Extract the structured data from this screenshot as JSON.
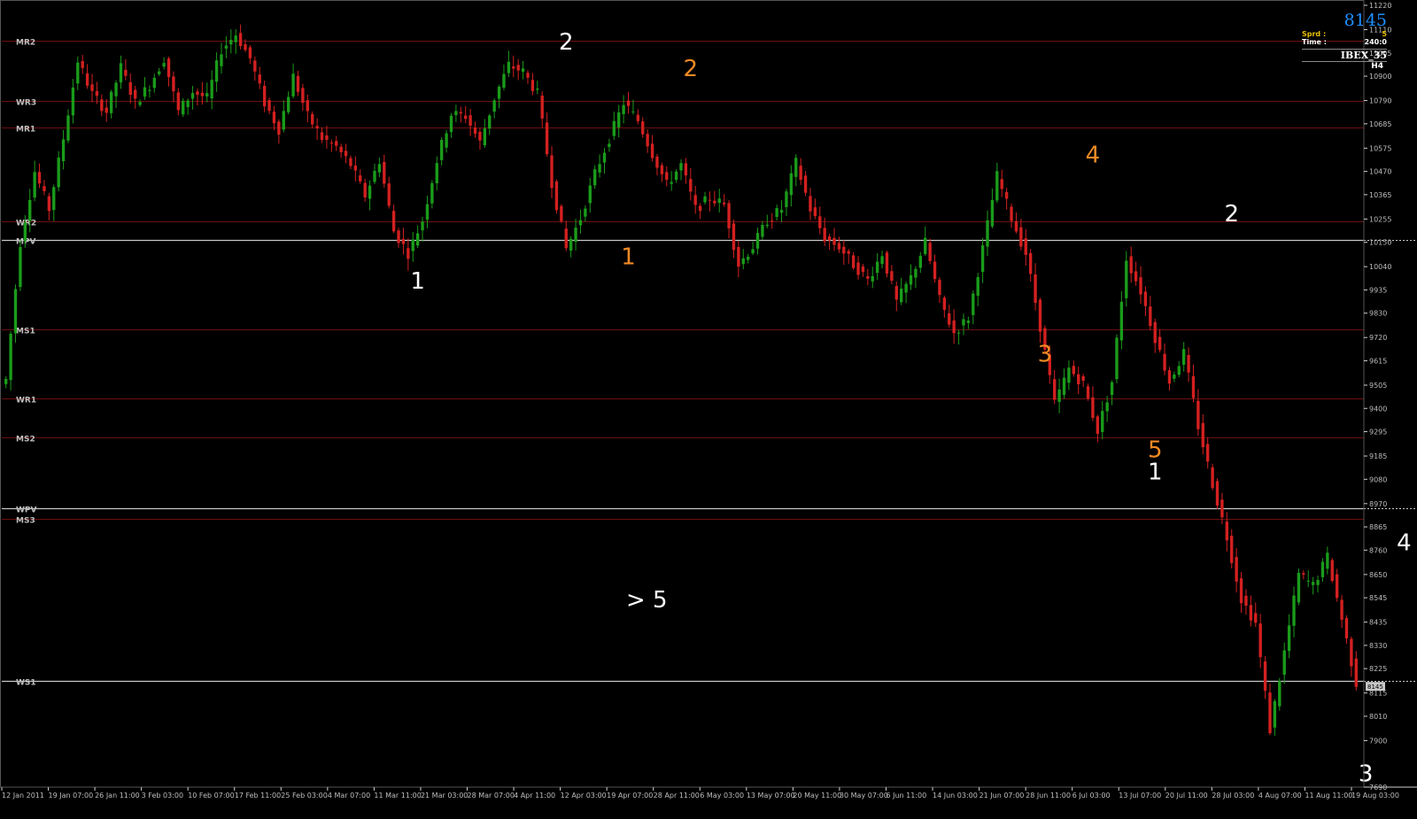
{
  "window": {
    "symbol": "IBEX_35",
    "timeframe": "H4"
  },
  "info_panel": {
    "price": "8145",
    "spread_label": "Sprd :",
    "spread_value": "5",
    "time_label": "Time :",
    "time_value": "240:0",
    "symbol": "IBEX_35",
    "timeframe": "H4"
  },
  "colors": {
    "bull": "#1a9c1a",
    "bear": "#d42020",
    "grid": "#6b1010",
    "pivot_line": "#c8c8c8",
    "wave_white": "#ffffff",
    "wave_orange": "#f08a24",
    "background": "#000000"
  },
  "current_price_tag": "8145",
  "chart_data": {
    "type": "candlestick",
    "ylim": [
      7690,
      11220
    ],
    "y_ticks": [
      11220,
      11110,
      11005,
      10900,
      10790,
      10685,
      10575,
      10470,
      10365,
      10255,
      10150,
      10040,
      9935,
      9830,
      9720,
      9615,
      9505,
      9400,
      9295,
      9185,
      9080,
      8970,
      8865,
      8760,
      8650,
      8545,
      8435,
      8330,
      8225,
      8115,
      8010,
      7900,
      7690
    ],
    "x_ticks": [
      "12 Jan 2011",
      "19 Jan 07:00",
      "26 Jan 11:00",
      "3 Feb 03:00",
      "10 Feb 07:00",
      "17 Feb 11:00",
      "25 Feb 03:00",
      "4 Mar 07:00",
      "11 Mar 11:00",
      "21 Mar 03:00",
      "28 Mar 07:00",
      "4 Apr 11:00",
      "12 Apr 03:00",
      "19 Apr 07:00",
      "28 Apr 11:00",
      "6 May 03:00",
      "13 May 07:00",
      "20 May 11:00",
      "30 May 07:00",
      "6 Jun 11:00",
      "14 Jun 03:00",
      "21 Jun 07:00",
      "28 Jun 11:00",
      "6 Jul 03:00",
      "13 Jul 07:00",
      "20 Jul 11:00",
      "28 Jul 03:00",
      "4 Aug 07:00",
      "11 Aug 11:00",
      "19 Aug 03:00"
    ],
    "pivot_levels": [
      {
        "label": "MR2",
        "value": 11060,
        "style": "grid"
      },
      {
        "label": "WR3",
        "value": 10790,
        "style": "grid"
      },
      {
        "label": "MR1",
        "value": 10670,
        "style": "grid"
      },
      {
        "label": "WR2",
        "value": 10245,
        "style": "grid"
      },
      {
        "label": "MPV",
        "value": 10160,
        "style": "line"
      },
      {
        "label": "MS1",
        "value": 9755,
        "style": "grid"
      },
      {
        "label": "WR1",
        "value": 9445,
        "style": "grid"
      },
      {
        "label": "MS2",
        "value": 9270,
        "style": "grid"
      },
      {
        "label": "WPV",
        "value": 8950,
        "style": "line"
      },
      {
        "label": "MS3",
        "value": 8900,
        "style": "grid"
      },
      {
        "label": "WS1",
        "value": 8170,
        "style": "line"
      }
    ],
    "key_points": [
      [
        0,
        9530
      ],
      [
        3,
        10150
      ],
      [
        6,
        10470
      ],
      [
        9,
        10300
      ],
      [
        12,
        10620
      ],
      [
        15,
        10970
      ],
      [
        18,
        10820
      ],
      [
        21,
        10740
      ],
      [
        24,
        10940
      ],
      [
        27,
        10780
      ],
      [
        30,
        10860
      ],
      [
        33,
        10980
      ],
      [
        36,
        10740
      ],
      [
        39,
        10830
      ],
      [
        42,
        10800
      ],
      [
        45,
        11020
      ],
      [
        48,
        11090
      ],
      [
        51,
        10980
      ],
      [
        54,
        10780
      ],
      [
        57,
        10660
      ],
      [
        60,
        10900
      ],
      [
        63,
        10720
      ],
      [
        66,
        10620
      ],
      [
        69,
        10580
      ],
      [
        72,
        10500
      ],
      [
        75,
        10360
      ],
      [
        78,
        10520
      ],
      [
        81,
        10200
      ],
      [
        84,
        10100
      ],
      [
        87,
        10250
      ],
      [
        90,
        10520
      ],
      [
        93,
        10730
      ],
      [
        96,
        10720
      ],
      [
        99,
        10600
      ],
      [
        102,
        10800
      ],
      [
        105,
        10950
      ],
      [
        108,
        10920
      ],
      [
        111,
        10820
      ],
      [
        114,
        10420
      ],
      [
        117,
        10120
      ],
      [
        120,
        10260
      ],
      [
        123,
        10460
      ],
      [
        126,
        10620
      ],
      [
        129,
        10780
      ],
      [
        132,
        10700
      ],
      [
        135,
        10550
      ],
      [
        138,
        10410
      ],
      [
        141,
        10500
      ],
      [
        144,
        10300
      ],
      [
        147,
        10350
      ],
      [
        150,
        10320
      ],
      [
        153,
        10050
      ],
      [
        156,
        10130
      ],
      [
        159,
        10250
      ],
      [
        162,
        10300
      ],
      [
        165,
        10510
      ],
      [
        168,
        10300
      ],
      [
        171,
        10170
      ],
      [
        174,
        10130
      ],
      [
        177,
        10050
      ],
      [
        180,
        9980
      ],
      [
        183,
        10100
      ],
      [
        186,
        9880
      ],
      [
        189,
        9990
      ],
      [
        192,
        10150
      ],
      [
        195,
        9890
      ],
      [
        198,
        9740
      ],
      [
        201,
        9810
      ],
      [
        204,
        10120
      ],
      [
        207,
        10450
      ],
      [
        210,
        10260
      ],
      [
        213,
        10100
      ],
      [
        216,
        9770
      ],
      [
        219,
        9420
      ],
      [
        222,
        9580
      ],
      [
        225,
        9510
      ],
      [
        228,
        9300
      ],
      [
        231,
        9520
      ],
      [
        234,
        10080
      ],
      [
        237,
        9930
      ],
      [
        240,
        9720
      ],
      [
        243,
        9520
      ],
      [
        246,
        9650
      ],
      [
        249,
        9320
      ],
      [
        252,
        9060
      ],
      [
        255,
        8820
      ],
      [
        258,
        8540
      ],
      [
        261,
        8430
      ],
      [
        264,
        7950
      ],
      [
        267,
        8300
      ],
      [
        270,
        8650
      ],
      [
        273,
        8600
      ],
      [
        276,
        8730
      ],
      [
        279,
        8450
      ],
      [
        282,
        8160
      ]
    ],
    "wave_labels": [
      {
        "text": "1",
        "color": "white",
        "x": 86,
        "y": 9940
      },
      {
        "text": "2",
        "color": "white",
        "x": 117,
        "y": 11020
      },
      {
        "text": "1",
        "color": "orange",
        "x": 130,
        "y": 10050
      },
      {
        "text": "2",
        "color": "orange",
        "x": 143,
        "y": 10900
      },
      {
        "text": "4",
        "color": "orange",
        "x": 227,
        "y": 10510
      },
      {
        "text": "3",
        "color": "orange",
        "x": 217,
        "y": 9610
      },
      {
        "text": "5",
        "color": "orange",
        "x": 240,
        "y": 9180
      },
      {
        "text": "1",
        "color": "white",
        "x": 240,
        "y": 9080
      },
      {
        "text": "2",
        "color": "white",
        "x": 256,
        "y": 10245
      },
      {
        "text": "4",
        "color": "white",
        "x": 292,
        "y": 8760
      },
      {
        "text": "3",
        "color": "white",
        "x": 284,
        "y": 7715
      }
    ],
    "annotation": "> 5"
  }
}
